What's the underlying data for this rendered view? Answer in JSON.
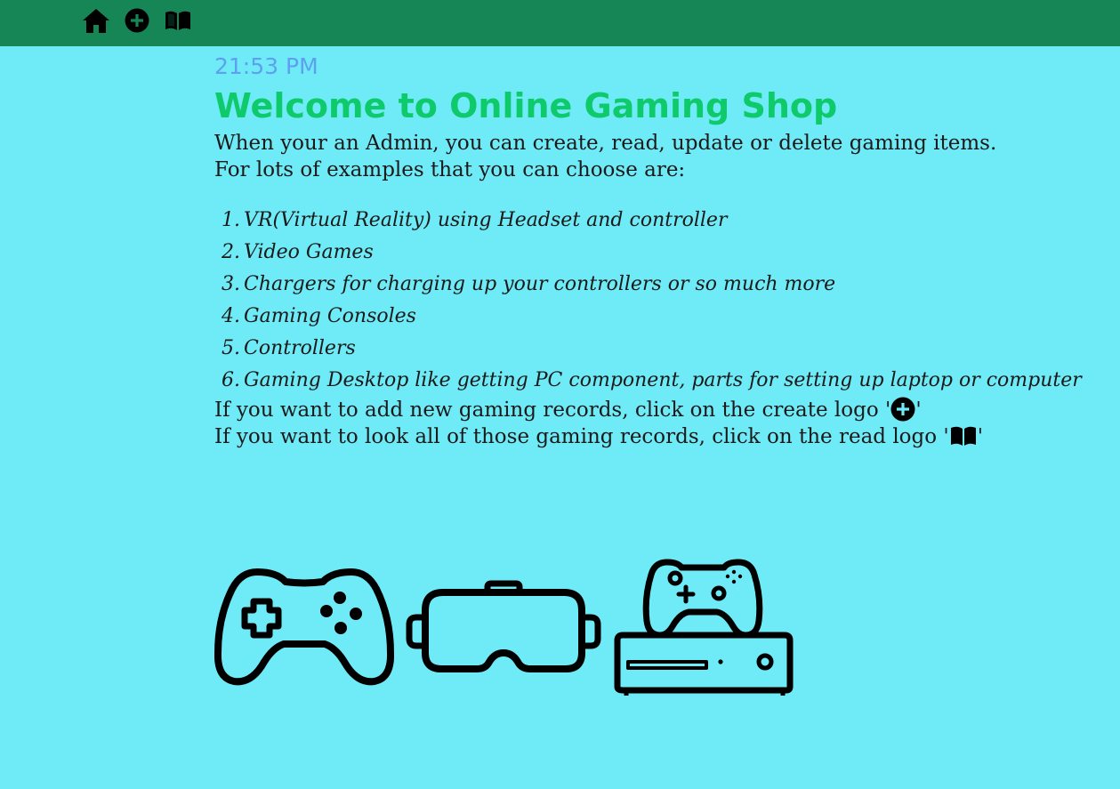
{
  "nav": {
    "icons": [
      "home-icon",
      "plus-circle-icon",
      "book-icon"
    ],
    "bar_color": "#178656"
  },
  "main": {
    "time": "21:53 PM",
    "title": "Welcome to Online Gaming Shop",
    "intro": "When your an Admin, you can create, read, update or delete gaming items.",
    "examples_intro": "For lots of examples that you can choose are:",
    "examples": [
      "VR(Virtual Reality) using Headset and controller",
      "Video Games",
      "Chargers for charging up your controllers or so much more",
      "Gaming Consoles",
      "Controllers",
      "Gaming Desktop like getting PC component, parts for setting up laptop or computer"
    ],
    "examples_numbers": [
      "1.",
      "2.",
      "3.",
      "4.",
      "5.",
      "6."
    ],
    "create_hint_before": "If you want to add new gaming records, click on the create logo '",
    "create_hint_after": "'",
    "read_hint_before": "If you want to look all of those gaming records, click on the read logo '",
    "read_hint_after": "'"
  },
  "gallery": {
    "icons": [
      "gamepad-icon",
      "vr-headset-icon",
      "game-console-icon"
    ]
  },
  "colors": {
    "background": "#6eebf7",
    "time": "#5f9ff0",
    "title": "#0fca6a"
  }
}
